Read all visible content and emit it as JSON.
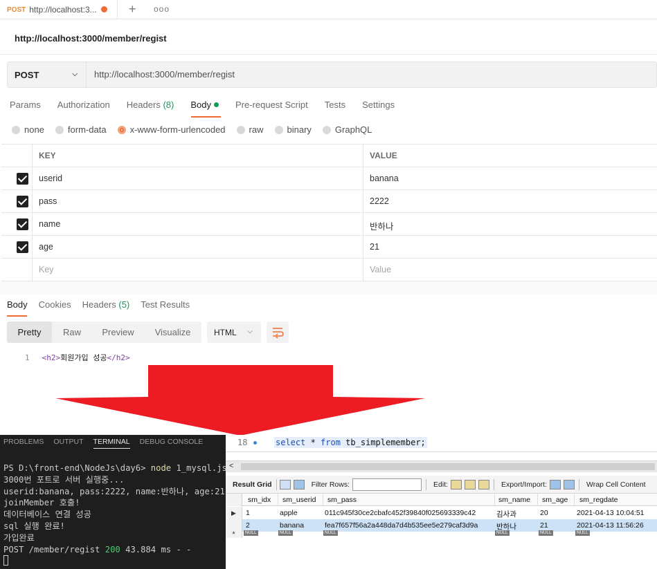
{
  "postman": {
    "tab": {
      "method": "POST",
      "url": "http://localhost:3..."
    },
    "tab_actions": {
      "new": "+",
      "more": "ooo"
    },
    "request_title": "http://localhost:3000/member/regist",
    "method": "POST",
    "url": "http://localhost:3000/member/regist",
    "request_tabs": [
      {
        "label": "Params"
      },
      {
        "label": "Authorization"
      },
      {
        "label": "Headers",
        "count": "(8)"
      },
      {
        "label": "Body"
      },
      {
        "label": "Pre-request Script"
      },
      {
        "label": "Tests"
      },
      {
        "label": "Settings"
      }
    ],
    "body_types": [
      "none",
      "form-data",
      "x-www-form-urlencoded",
      "raw",
      "binary",
      "GraphQL"
    ],
    "body_type_selected": "x-www-form-urlencoded",
    "params_header": {
      "key": "KEY",
      "value": "VALUE"
    },
    "params": [
      {
        "key": "userid",
        "value": "banana"
      },
      {
        "key": "pass",
        "value": "2222"
      },
      {
        "key": "name",
        "value": "반하나"
      },
      {
        "key": "age",
        "value": "21"
      }
    ],
    "params_placeholder": {
      "key": "Key",
      "value": "Value"
    },
    "response_tabs": [
      {
        "label": "Body"
      },
      {
        "label": "Cookies"
      },
      {
        "label": "Headers",
        "count": "(5)"
      },
      {
        "label": "Test Results"
      }
    ],
    "view_modes": [
      "Pretty",
      "Raw",
      "Preview",
      "Visualize"
    ],
    "format": "HTML",
    "response_line_number": "1",
    "response_open_tag": "<h2>",
    "response_text": "회원가입 성공",
    "response_close_tag": "</h2>"
  },
  "terminal": {
    "tabs": [
      "PROBLEMS",
      "OUTPUT",
      "TERMINAL",
      "DEBUG CONSOLE"
    ],
    "active_tab": "TERMINAL",
    "prompt": "PS D:\\front-end\\NodeJs\\day6> ",
    "command": "node",
    "command_arg": " 1_mysql.js",
    "lines": [
      "3000번 포트로 서버 실행중...",
      "userid:banana, pass:2222, name:반하나, age:21",
      "joinMember 호출!",
      "데이터베이스 연결 성공",
      "sql 실행 완료!",
      "가입완료"
    ],
    "log_prefix": "POST /member/regist ",
    "log_status": "200",
    "log_suffix": " 43.884 ms - -"
  },
  "workbench": {
    "line_number": "18",
    "sql_keyword_1": "select",
    "sql_star": " * ",
    "sql_keyword_2": "from",
    "sql_rest": " tb_simplemember;",
    "toolbar": {
      "result_grid": "Result Grid",
      "filter_rows": "Filter Rows:",
      "edit": "Edit:",
      "export_import": "Export/Import:",
      "wrap_cell": "Wrap Cell Content"
    },
    "columns": [
      "sm_idx",
      "sm_userid",
      "sm_pass",
      "sm_name",
      "sm_age",
      "sm_regdate"
    ],
    "rows": [
      [
        "1",
        "apple",
        "011c945f30ce2cbafc452f39840f025693339c42",
        "김사과",
        "20",
        "2021-04-13 10:04:51"
      ],
      [
        "2",
        "banana",
        "fea7f657f56a2a448da7d4b535ee5e279caf3d9a",
        "반하나",
        "21",
        "2021-04-13 11:56:26"
      ]
    ],
    "null_label": "NULL",
    "new_row_marker": "*"
  },
  "colors": {
    "postman_accent": "#f06a33",
    "postman_green": "#0d9d58",
    "arrow_red": "#ed1c24",
    "terminal_bg": "#1e1e1e"
  }
}
